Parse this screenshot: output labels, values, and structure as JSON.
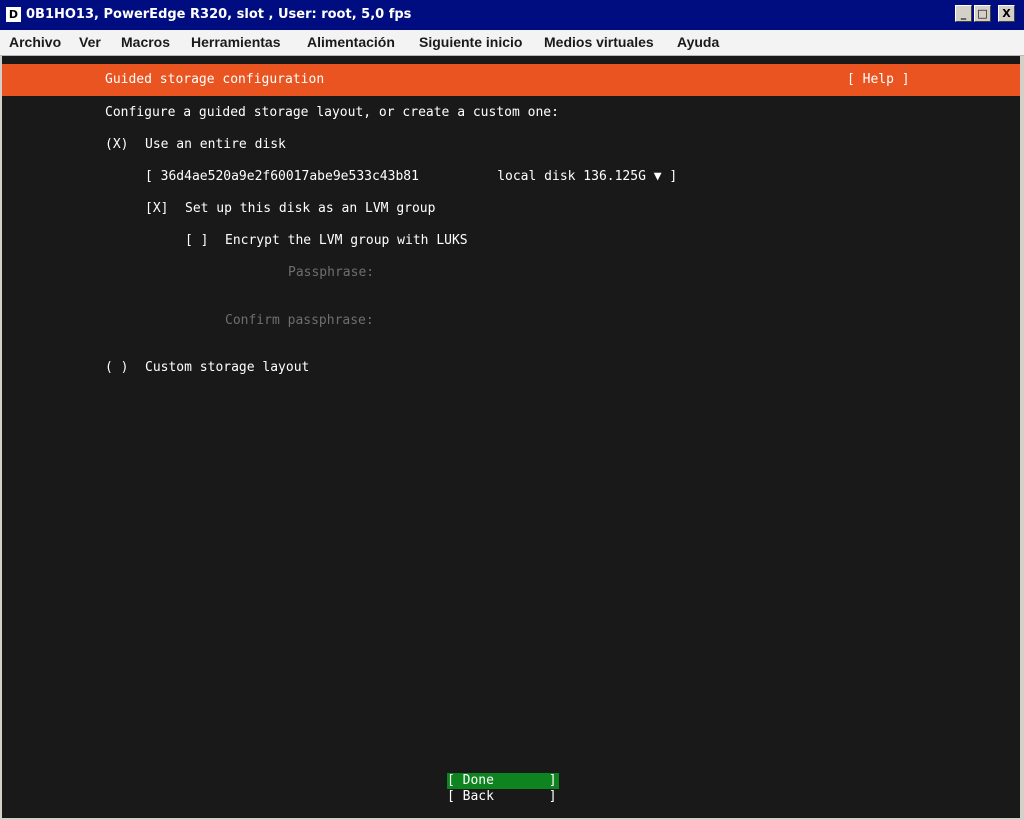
{
  "window": {
    "icon_letter": "D",
    "title": "0B1HO13, PowerEdge R320,  slot , User: root, 5,0 fps",
    "buttons": {
      "minimize": "_",
      "maximize": "□",
      "close": "X"
    }
  },
  "menu": [
    "Archivo",
    "Ver",
    "Macros",
    "Herramientas",
    "Alimentación",
    "Siguiente inicio",
    "Medios virtuales",
    "Ayuda"
  ],
  "installer": {
    "header_title": "Guided storage configuration",
    "help": "[ Help ]",
    "intro": "Configure a guided storage layout, or create a custom one:",
    "entire_disk_radio": "(X)",
    "entire_disk_label": "Use an entire disk",
    "disk_select": "[ 36d4ae520a9e2f60017abe9e533c43b81          local disk 136.125G ▼ ]",
    "lvm_checkbox": "[X]",
    "lvm_label": "Set up this disk as an LVM group",
    "luks_checkbox": "[ ]",
    "luks_label": "Encrypt the LVM group with LUKS",
    "passphrase_label": "Passphrase:",
    "confirm_passphrase_label": "Confirm passphrase:",
    "custom_radio": "( )",
    "custom_label": "Custom storage layout",
    "done_button": "[ Done       ]",
    "back_button": "[ Back       ]"
  },
  "colors": {
    "titlebar": "#000d80",
    "header_accent": "#e95420",
    "done_highlight": "#0e8420",
    "console_bg": "#191919"
  }
}
